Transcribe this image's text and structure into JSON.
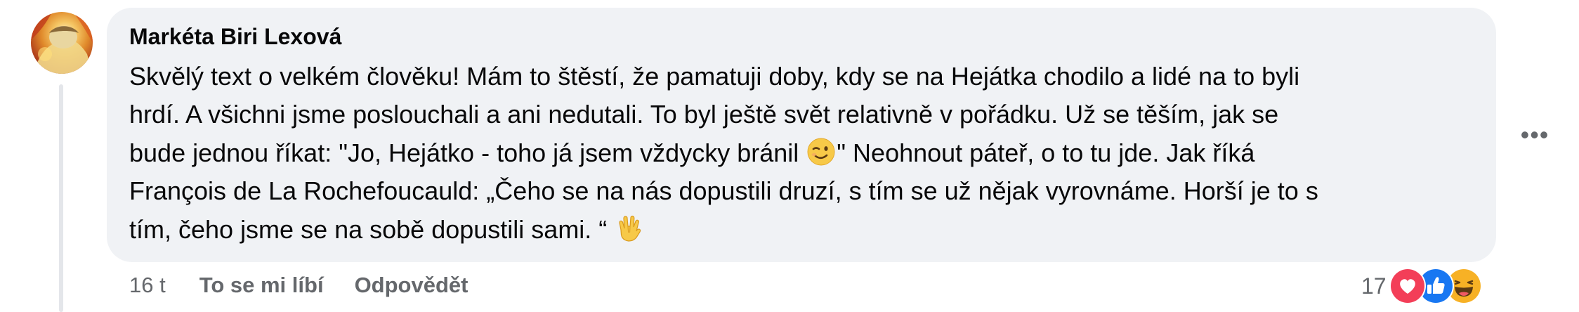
{
  "comment": {
    "author": "Markéta Biri Lexová",
    "lines": [
      "Skvělý text o velkém člověku! Mám to štěstí, že pamatuji doby, kdy se na Hejátka chodilo a lidé na to byli",
      "hrdí. A všichni jsme poslouchali a ani nedutali. To byl ještě svět relativně v pořádku. Už se těším, jak se",
      "bude jednou říkat: \"Jo, Hejátko - toho já jsem vždycky bránil",
      "\" Neohnout páteř, o to tu jde. Jak říká",
      "François de La Rochefoucauld: „Čeho se na nás dopustili druzí, s tím se už nějak vyrovnáme. Horší je to s",
      "tím, čeho jsme se na sobě dopustili sami. “"
    ],
    "emojis": [
      "winking-face-emoji",
      "vulcan-salute-emoji"
    ],
    "more_label": "•••"
  },
  "actions": {
    "time": "16 t",
    "like_label": "To se mi líbí",
    "reply_label": "Odpovědět"
  },
  "reactions": {
    "count": "17",
    "icons": [
      "love-reaction-icon",
      "like-reaction-icon",
      "haha-reaction-icon"
    ],
    "colors": {
      "love": "#f33e58",
      "like": "#1877f2",
      "haha": "#f7b125"
    }
  },
  "colors": {
    "bubble": "#f0f2f5",
    "text_primary": "#080809",
    "text_secondary": "#65686c"
  }
}
